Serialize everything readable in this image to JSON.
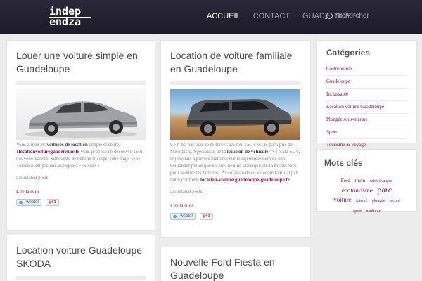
{
  "header": {
    "logo_line1": "indep",
    "logo_line2": "endza",
    "nav": [
      "ACCUEIL",
      "CONTACT",
      "GUADELOUPE"
    ],
    "search_placeholder": "rechercher"
  },
  "posts": [
    {
      "title": "Louer une voiture simple en Guadeloupe",
      "excerpt_parts": [
        "Vous aimez les ",
        "voitures de location",
        " simple et sobre, ",
        "1locationvoitureguadeloupe.fr",
        " vous propose de découvrir cette nouvelle Tolédo.  Silhouette de berline tricorps, robe sage, cette Tolédo n’est pas une espagnole « olé olé »"
      ],
      "no_related": "No related posts.",
      "read_more": "Lire la suite",
      "tweet": "Tweeter",
      "gplus": "g+1"
    },
    {
      "title": "Location de voiture familiale en Guadeloupe",
      "excerpt_parts": [
        "Ce n’est pas bon de se forcer. En tout cas, c’est le parti pris par Mitsubishi. Spécialiste de la ",
        "location de véhicule",
        " 4×4 et du SUV, le japonais a préféré plancher sur le rajeunissement de son Outlander plutôt que sur une berline classique ou un monospace pour séduire les familles.  Petite visite de ce véhicule familial par notre confrère, ",
        "location-voiture.guadeloupe-guadeloupe.fr"
      ],
      "no_related": "No related posts.",
      "read_more": "Lire la suite",
      "tweet": "Tweeter",
      "gplus": "g+1"
    },
    {
      "title": "Location voiture Guadeloupe SKODA"
    },
    {
      "title": "Nouvelle Ford Fiesta en Guadeloupe"
    }
  ],
  "sidebar": {
    "categories_title": "Catégories",
    "categories": [
      "Gastronomie",
      "Guadeloupe",
      "Inclassable",
      "Location voiture Guadeloupe",
      "Plongée sous-marine",
      "Sport",
      "Tourisme & Voyage"
    ],
    "tags_title": "Mots clés",
    "tags": [
      "Ford",
      "rhum",
      "saint-françois",
      "écotourisme",
      "parc",
      "voiture",
      "kiteurf",
      "plongée",
      "alcool",
      "sport",
      "nautique"
    ]
  },
  "colors": {
    "accent": "#8b1a4a",
    "header_bg": "#1d1b29",
    "page_bg": "#ececec"
  }
}
